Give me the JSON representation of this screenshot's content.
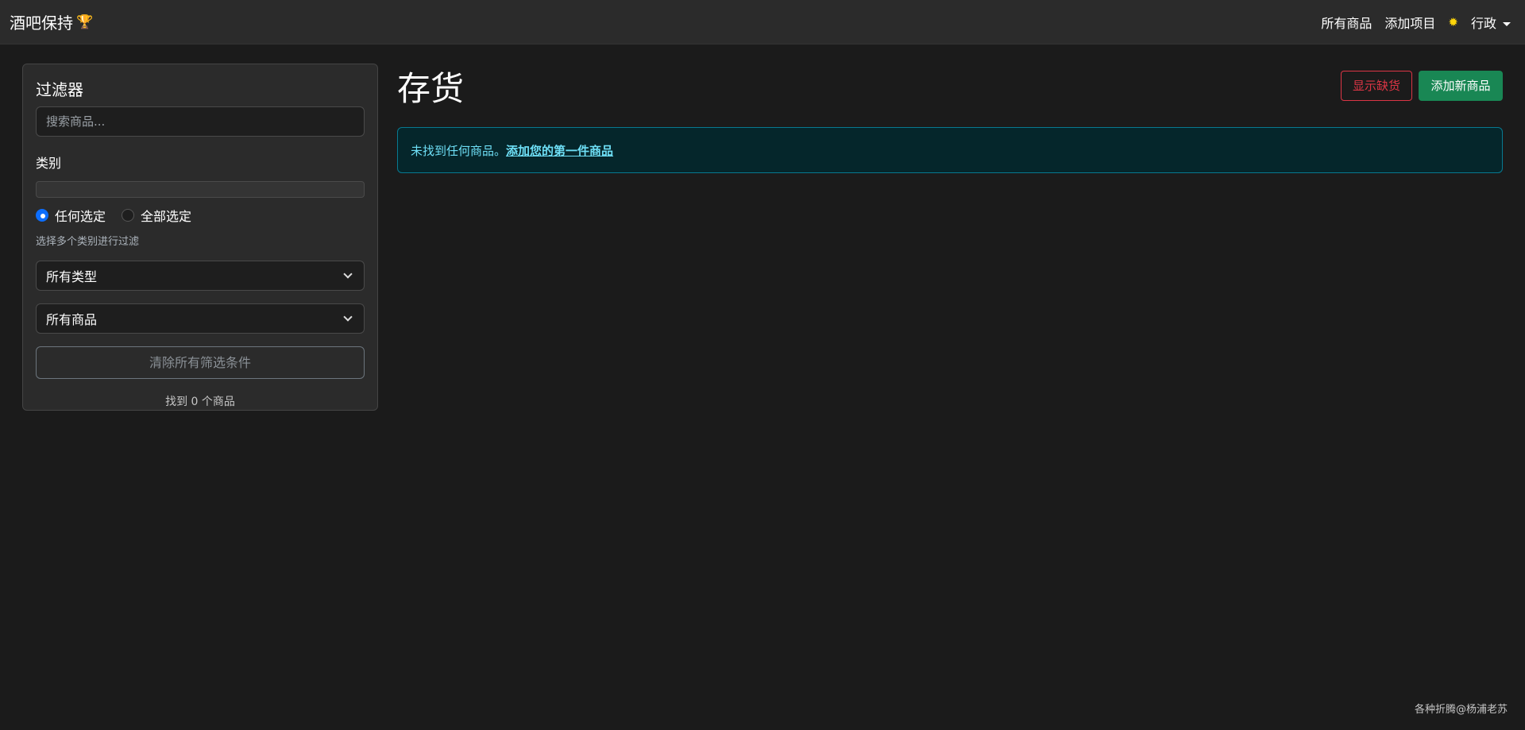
{
  "navbar": {
    "brand": "酒吧保持",
    "brand_icon": "trophy-icon",
    "links": [
      "所有商品",
      "添加项目"
    ],
    "theme_icon": "sun-icon",
    "user_menu": "行政"
  },
  "sidebar": {
    "title": "过滤器",
    "search_placeholder": "搜索商品...",
    "category_label": "类别",
    "match_any": "任何选定",
    "match_all": "全部选定",
    "hint": "选择多个类别进行过滤",
    "type_select": "所有类型",
    "item_select": "所有商品",
    "clear_button": "清除所有筛选条件",
    "found_text": "找到 0 个商品"
  },
  "main": {
    "title": "存货",
    "show_low_stock": "显示缺货",
    "add_new": "添加新商品",
    "alert_text": "未找到任何商品。",
    "alert_link": "添加您的第一件商品"
  },
  "footer": "各种折腾@杨浦老苏",
  "colors": {
    "background": "#1b1b1b",
    "navbar": "#2b2b2b",
    "danger": "#dc3545",
    "success": "#198754",
    "info": "#6edff6",
    "primary": "#0d6efd"
  }
}
